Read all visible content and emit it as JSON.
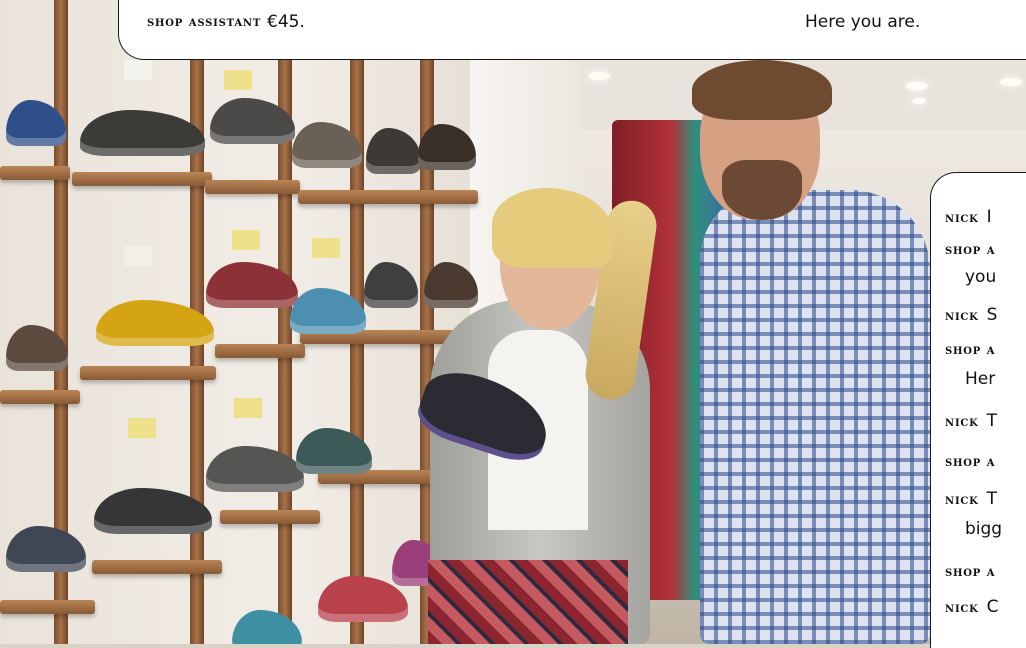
{
  "top_box": {
    "speaker": "shop assistant",
    "line": "€45.",
    "reply": "Here you are."
  },
  "right_box": {
    "l1_speaker": "nick",
    "l1_text": "I",
    "l2_speaker": "shop a",
    "l2_cont": "you",
    "l3_speaker": "nick",
    "l3_text": "S",
    "l4_speaker": "shop a",
    "l4_cont": "Her",
    "l5_speaker": "nick",
    "l5_text": "T",
    "l6_speaker": "shop a",
    "l7_speaker": "nick",
    "l7_text": "T",
    "l7_cont": "bigg",
    "l8_speaker": "shop a",
    "l9_speaker": "nick",
    "l9_text": "C"
  }
}
